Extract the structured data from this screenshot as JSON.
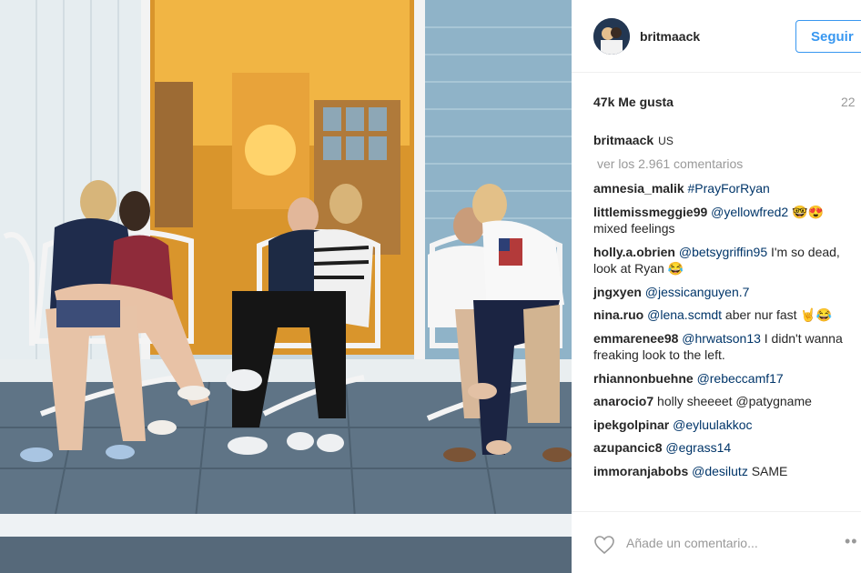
{
  "post": {
    "username": "britmaack",
    "follow_label": "Seguir",
    "likes": "47k Me gusta",
    "time_ago": "22",
    "caption_user": "britmaack",
    "caption_text": "US",
    "view_all": "ver los 2.961 comentarios",
    "add_comment_placeholder": "Añade un comentario...",
    "more_icon": "ellipsis-icon",
    "like_icon": "heart-outline-icon"
  },
  "comments": [
    {
      "user": "amnesia_malik",
      "mention": "#PrayForRyan",
      "text": ""
    },
    {
      "user": "littlemissmeggie99",
      "mention": "@yellowfred2",
      "text": " 🤓😍 mixed feelings"
    },
    {
      "user": "holly.a.obrien",
      "mention": "@betsygriffin95",
      "text": " I'm so dead, look at Ryan 😂"
    },
    {
      "user": "jngxyen",
      "mention": "@jessicanguyen.7",
      "text": ""
    },
    {
      "user": "nina.ruo",
      "mention": "@lena.scmdt",
      "text": " aber nur fast 🤘😂"
    },
    {
      "user": "emmarenee98",
      "mention": "@hrwatson13",
      "text": " I didn't wanna freaking look to the left."
    },
    {
      "user": "rhiannonbuehne",
      "mention": "@rebeccamf17",
      "text": ""
    },
    {
      "user": "anarocio7",
      "mention": "",
      "text": " holly sheeeet @patygname"
    },
    {
      "user": "ipekgolpinar",
      "mention": "@eyluulakkoc",
      "text": ""
    },
    {
      "user": "azupancic8",
      "mention": "@egrass14",
      "text": ""
    },
    {
      "user": "immoranjabobs",
      "mention": "@desilutz",
      "text": " SAME"
    }
  ]
}
